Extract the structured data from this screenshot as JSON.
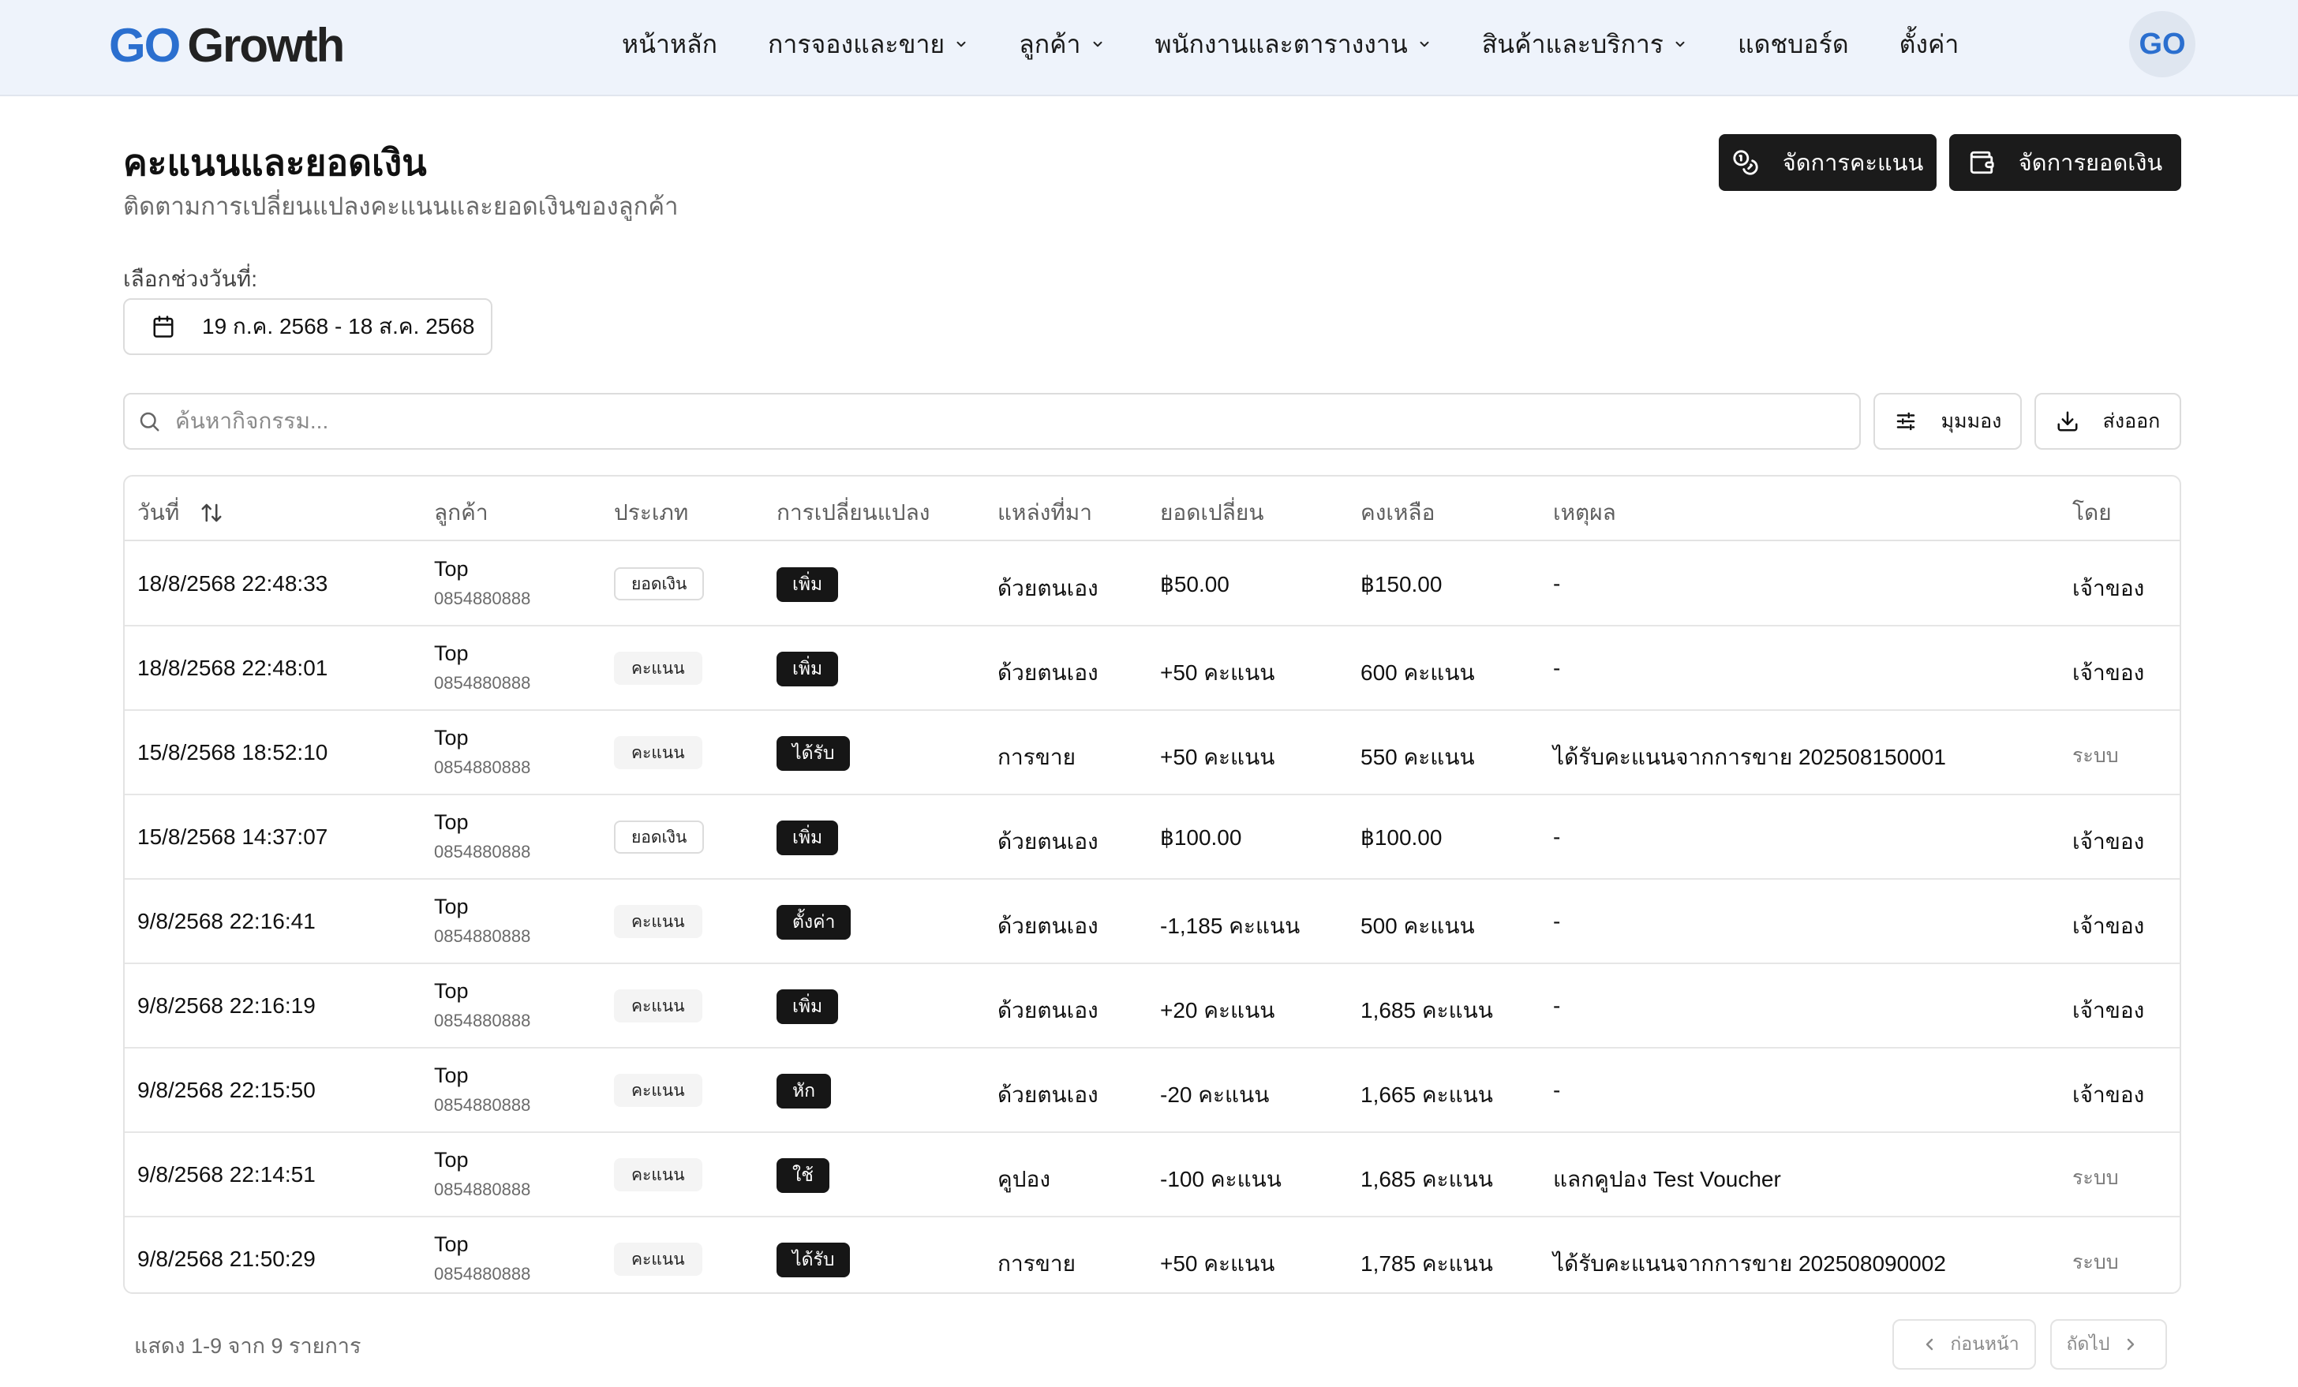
{
  "brand": {
    "logo_go": "GO",
    "logo_growth": "Growth",
    "avatar": "GO"
  },
  "nav": [
    {
      "label": "หน้าหลัก",
      "dropdown": false
    },
    {
      "label": "การจองและขาย",
      "dropdown": true
    },
    {
      "label": "ลูกค้า",
      "dropdown": true
    },
    {
      "label": "พนักงานและตารางงาน",
      "dropdown": true
    },
    {
      "label": "สินค้าและบริการ",
      "dropdown": true
    },
    {
      "label": "แดชบอร์ด",
      "dropdown": false
    },
    {
      "label": "ตั้งค่า",
      "dropdown": false
    }
  ],
  "header": {
    "title": "คะแนนและยอดเงิน",
    "subtitle": "ติดตามการเปลี่ยนแปลงคะแนนและยอดเงินของลูกค้า",
    "manage_points": "จัดการคะแนน",
    "manage_balance": "จัดการยอดเงิน"
  },
  "date_filter": {
    "label": "เลือกช่วงวันที่:",
    "value": "19 ก.ค. 2568 - 18 ส.ค. 2568"
  },
  "toolbar": {
    "search_placeholder": "ค้นหากิจกรรม...",
    "view_label": "มุมมอง",
    "export_label": "ส่งออก"
  },
  "table": {
    "columns": {
      "date": "วันที่",
      "customer": "ลูกค้า",
      "type": "ประเภท",
      "change": "การเปลี่ยนแปลง",
      "source": "แหล่งที่มา",
      "amount": "ยอดเปลี่ยน",
      "remaining": "คงเหลือ",
      "reason": "เหตุผล",
      "by": "โดย"
    },
    "rows": [
      {
        "date": "18/8/2568 22:48:33",
        "name": "Top",
        "phone": "0854880888",
        "type": "ยอดเงิน",
        "type_kind": "balance",
        "change": "เพิ่ม",
        "source": "ด้วยตนเอง",
        "amount": "฿50.00",
        "remaining": "฿150.00",
        "reason": "-",
        "by": "เจ้าของ",
        "by_system": false
      },
      {
        "date": "18/8/2568 22:48:01",
        "name": "Top",
        "phone": "0854880888",
        "type": "คะแนน",
        "type_kind": "points",
        "change": "เพิ่ม",
        "source": "ด้วยตนเอง",
        "amount": "+50 คะแนน",
        "remaining": "600 คะแนน",
        "reason": "-",
        "by": "เจ้าของ",
        "by_system": false
      },
      {
        "date": "15/8/2568 18:52:10",
        "name": "Top",
        "phone": "0854880888",
        "type": "คะแนน",
        "type_kind": "points",
        "change": "ได้รับ",
        "source": "การขาย",
        "amount": "+50 คะแนน",
        "remaining": "550 คะแนน",
        "reason": "ได้รับคะแนนจากการขาย 202508150001",
        "by": "ระบบ",
        "by_system": true
      },
      {
        "date": "15/8/2568 14:37:07",
        "name": "Top",
        "phone": "0854880888",
        "type": "ยอดเงิน",
        "type_kind": "balance",
        "change": "เพิ่ม",
        "source": "ด้วยตนเอง",
        "amount": "฿100.00",
        "remaining": "฿100.00",
        "reason": "-",
        "by": "เจ้าของ",
        "by_system": false
      },
      {
        "date": "9/8/2568 22:16:41",
        "name": "Top",
        "phone": "0854880888",
        "type": "คะแนน",
        "type_kind": "points",
        "change": "ตั้งค่า",
        "source": "ด้วยตนเอง",
        "amount": "-1,185 คะแนน",
        "remaining": "500 คะแนน",
        "reason": "-",
        "by": "เจ้าของ",
        "by_system": false
      },
      {
        "date": "9/8/2568 22:16:19",
        "name": "Top",
        "phone": "0854880888",
        "type": "คะแนน",
        "type_kind": "points",
        "change": "เพิ่ม",
        "source": "ด้วยตนเอง",
        "amount": "+20 คะแนน",
        "remaining": "1,685 คะแนน",
        "reason": "-",
        "by": "เจ้าของ",
        "by_system": false
      },
      {
        "date": "9/8/2568 22:15:50",
        "name": "Top",
        "phone": "0854880888",
        "type": "คะแนน",
        "type_kind": "points",
        "change": "หัก",
        "source": "ด้วยตนเอง",
        "amount": "-20 คะแนน",
        "remaining": "1,665 คะแนน",
        "reason": "-",
        "by": "เจ้าของ",
        "by_system": false
      },
      {
        "date": "9/8/2568 22:14:51",
        "name": "Top",
        "phone": "0854880888",
        "type": "คะแนน",
        "type_kind": "points",
        "change": "ใช้",
        "source": "คูปอง",
        "amount": "-100 คะแนน",
        "remaining": "1,685 คะแนน",
        "reason": "แลกคูปอง Test Voucher",
        "by": "ระบบ",
        "by_system": true
      },
      {
        "date": "9/8/2568 21:50:29",
        "name": "Top",
        "phone": "0854880888",
        "type": "คะแนน",
        "type_kind": "points",
        "change": "ได้รับ",
        "source": "การขาย",
        "amount": "+50 คะแนน",
        "remaining": "1,785 คะแนน",
        "reason": "ได้รับคะแนนจากการขาย 202508090002",
        "by": "ระบบ",
        "by_system": true
      }
    ]
  },
  "footer": {
    "summary": "แสดง 1-9 จาก 9 รายการ",
    "prev": "ก่อนหน้า",
    "next": "ถัดไป"
  }
}
